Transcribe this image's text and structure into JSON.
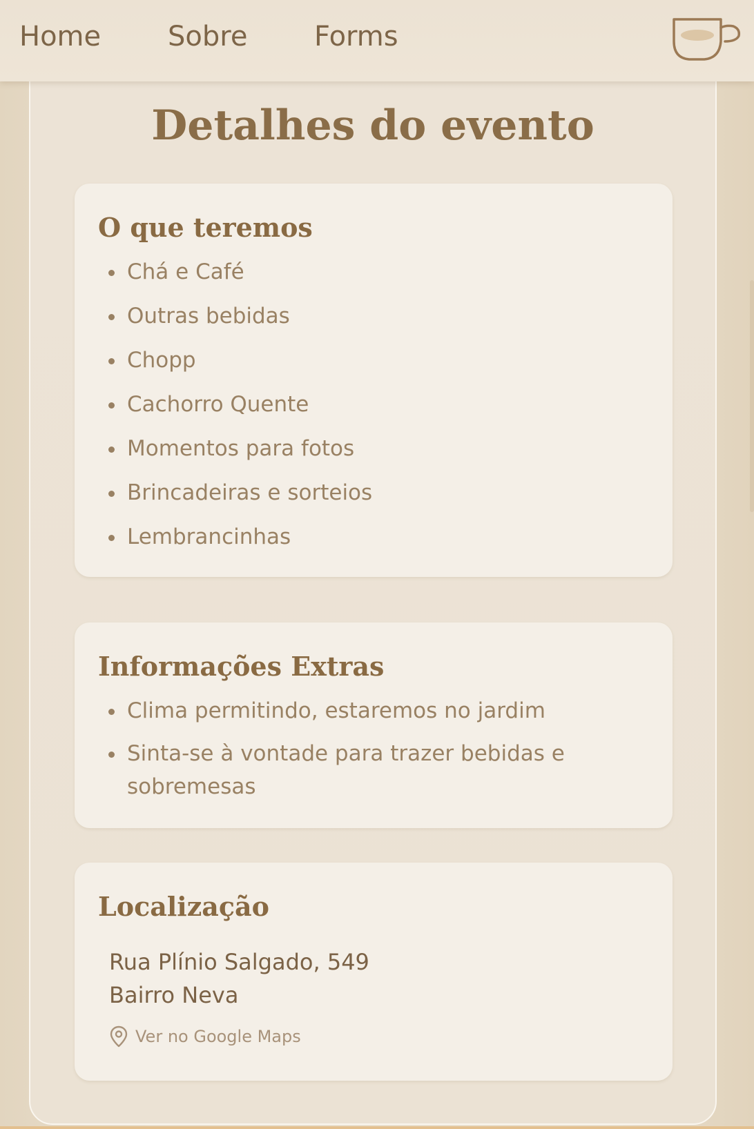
{
  "nav": {
    "home": "Home",
    "sobre": "Sobre",
    "forms": "Forms",
    "logo_icon": "coffee-cup-icon"
  },
  "page": {
    "title": "Detalhes do evento"
  },
  "cards": {
    "teremos": {
      "title": "O que teremos",
      "items": [
        "Chá e Café",
        "Outras bebidas",
        "Chopp",
        "Cachorro Quente",
        "Momentos para fotos",
        "Brincadeiras e sorteios",
        "Lembrancinhas"
      ]
    },
    "extras": {
      "title": "Informações Extras",
      "items": [
        "Clima permitindo, estaremos no jardim",
        "Sinta-se à vontade para trazer bebidas e sobremesas"
      ]
    },
    "localizacao": {
      "title": "Localização",
      "street": "Rua Plínio Salgado, 549",
      "district": "Bairro Neva",
      "maps_link": "Ver no Google Maps",
      "maps_icon": "map-pin-icon"
    }
  },
  "colors": {
    "background": "#e9dfcd",
    "card": "#f4efe7",
    "heading": "#8a6d48",
    "text": "#998163"
  }
}
